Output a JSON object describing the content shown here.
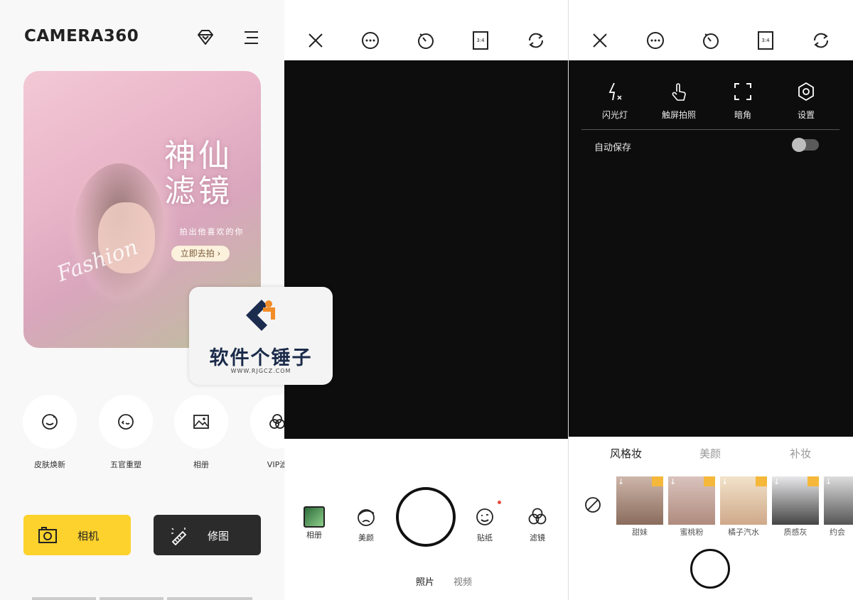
{
  "panel1": {
    "logo": "CAMERA360",
    "banner": {
      "title": "神仙滤镜",
      "subtitle": "拍出他喜欢的你",
      "cta": "立即去拍 ›",
      "script_text": "Fashion"
    },
    "features": [
      {
        "label": "皮肤焕新",
        "icon": "face-smile-icon"
      },
      {
        "label": "五官重塑",
        "icon": "face-reshape-icon"
      },
      {
        "label": "相册",
        "icon": "image-icon"
      },
      {
        "label": "VIP滤",
        "icon": "filter-circles-icon"
      }
    ],
    "buttons": {
      "camera": "相机",
      "edit": "修图"
    }
  },
  "watermark": {
    "text": "软件个锤子",
    "url": "WWW.RJGCZ.COM"
  },
  "panel2": {
    "tools_left": [
      {
        "label": "相册"
      },
      {
        "label": "美颜"
      }
    ],
    "tools_right": [
      {
        "label": "贴纸"
      },
      {
        "label": "滤镜"
      }
    ],
    "modes": {
      "photo": "照片",
      "video": "视频"
    },
    "ratio": "3:4"
  },
  "panel3": {
    "ratio": "3:4",
    "settings": [
      {
        "label": "闪光灯",
        "icon": "flash-off-icon"
      },
      {
        "label": "触屏拍照",
        "icon": "touch-shoot-icon"
      },
      {
        "label": "暗角",
        "icon": "vignette-icon"
      },
      {
        "label": "设置",
        "icon": "settings-hex-icon"
      }
    ],
    "autosave": {
      "label": "自动保存",
      "on": false
    },
    "tabs": [
      "风格妆",
      "美颜",
      "补妆"
    ],
    "styles": [
      {
        "label": "甜妹"
      },
      {
        "label": "蜜桃粉"
      },
      {
        "label": "橘子汽水"
      },
      {
        "label": "质感灰"
      },
      {
        "label": "约会"
      }
    ]
  },
  "colors": {
    "accent_yellow": "#fdd22d",
    "dark_button": "#2b2b2b",
    "viewfinder": "#0d0d0d",
    "red_dot": "#e94b3c"
  }
}
